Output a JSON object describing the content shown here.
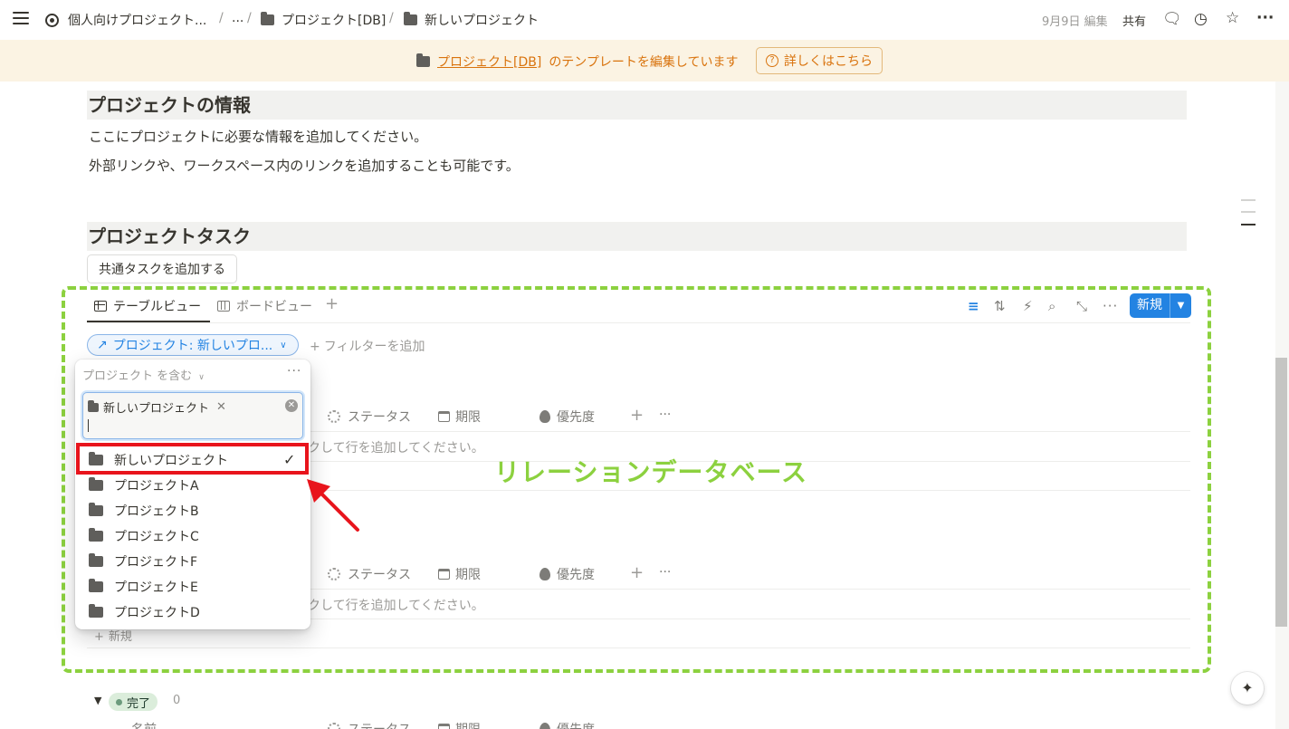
{
  "breadcrumb": {
    "workspace": "個人向けプロジェクト...",
    "ellipsis": "...",
    "db": "プロジェクト[DB]",
    "page": "新しいプロジェクト",
    "sep": "/"
  },
  "topbar": {
    "edited": "9月9日 編集",
    "share": "共有",
    "more": "···"
  },
  "banner": {
    "db_link": "プロジェクト[DB]",
    "text": "のテンプレートを編集しています",
    "learn_more": "詳しくはこちら"
  },
  "sections": {
    "info_heading": "プロジェクトの情報",
    "info_p1": "ここにプロジェクトに必要な情報を追加してください。",
    "info_p2": "外部リンクや、ワークスペース内のリンクを追加することも可能です。",
    "tasks_heading": "プロジェクトタスク",
    "add_common_task": "共通タスクを追加する"
  },
  "views": {
    "table": "テーブルビュー",
    "board": "ボードビュー",
    "new_label": "新規"
  },
  "filter": {
    "pill": "プロジェクト: 新しいプロ...",
    "add": "フィルターを追加"
  },
  "columns": {
    "status": "ステータス",
    "due": "期限",
    "priority": "優先度"
  },
  "empty_row_text": "クして行を追加してください。",
  "new_row": "新規",
  "popup": {
    "condition": "プロジェクト を含む",
    "selected_chip": "新しいプロジェクト",
    "options": [
      "新しいプロジェクト",
      "プロジェクトA",
      "プロジェクトB",
      "プロジェクトC",
      "プロジェクトF",
      "プロジェクトE",
      "プロジェクトD"
    ]
  },
  "annotation": {
    "label": "リレーションデータベース",
    "highlight_color": "#8cd13f",
    "selection_color": "#e8141c"
  },
  "group": {
    "status": "完了",
    "count": "0",
    "name_col": "名前"
  },
  "colors": {
    "accent": "#2383e2",
    "banner_bg": "#fbf3e3",
    "banner_text": "#d9730d"
  }
}
